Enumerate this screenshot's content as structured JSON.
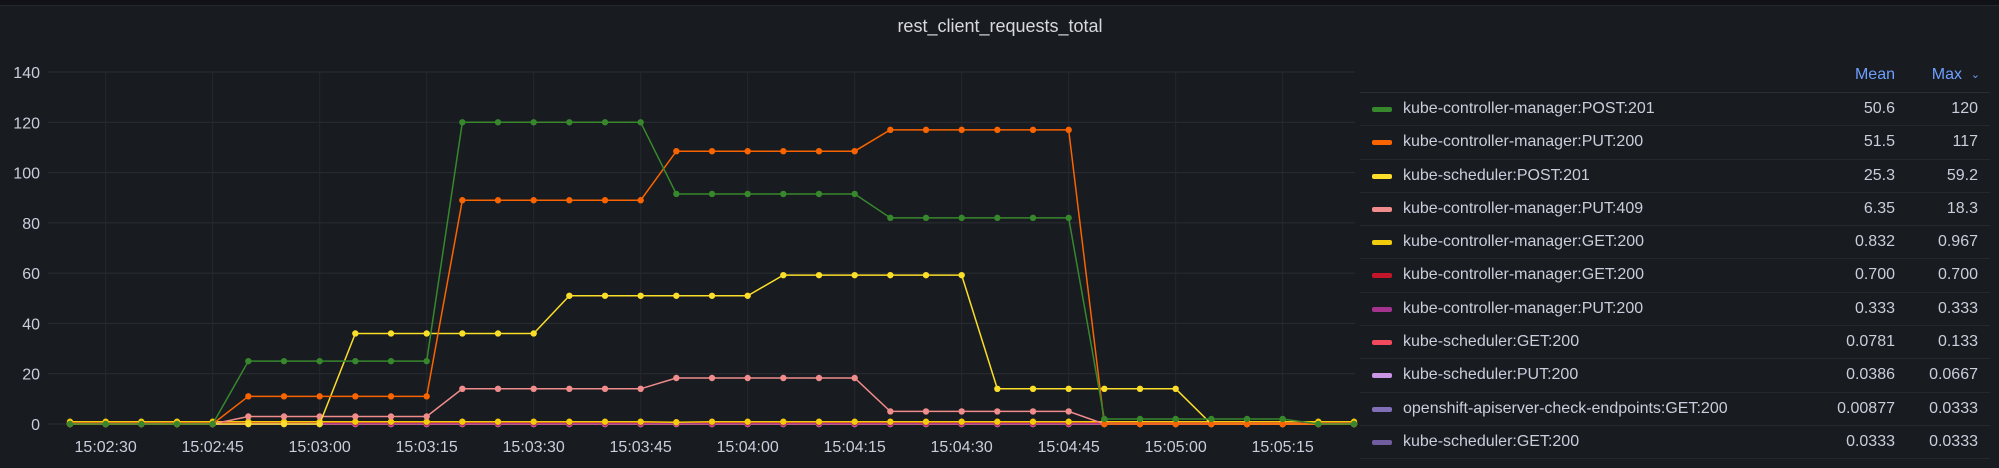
{
  "chart_data": {
    "type": "line",
    "title": "rest_client_requests_total",
    "xlabel": "",
    "ylabel": "",
    "ylim": [
      0,
      140
    ],
    "yticks": [
      "0",
      "20",
      "40",
      "60",
      "80",
      "100",
      "120",
      "140"
    ],
    "xticks": [
      "15:02:30",
      "15:02:45",
      "15:03:00",
      "15:03:15",
      "15:03:30",
      "15:03:45",
      "15:04:00",
      "15:04:15",
      "15:04:30",
      "15:04:45",
      "15:05:00",
      "15:05:15"
    ],
    "x_start": "15:02:25",
    "x_step_seconds": 5,
    "grid": true,
    "legend_placement": "right",
    "legend_columns": [
      "Mean",
      "Max"
    ],
    "series": [
      {
        "name": "kube-controller-manager:POST:201",
        "color": "#37872d",
        "mean": "50.6",
        "max": "120",
        "values": [
          0,
          0,
          0,
          0,
          0,
          25,
          25,
          25,
          25,
          25,
          25,
          120,
          120,
          120,
          120,
          120,
          120,
          91.5,
          91.5,
          91.5,
          91.5,
          91.5,
          91.5,
          82,
          82,
          82,
          82,
          82,
          82,
          2,
          2,
          2,
          2,
          2,
          2,
          0,
          0
        ]
      },
      {
        "name": "kube-controller-manager:PUT:200",
        "color": "#fa6400",
        "mean": "51.5",
        "max": "117",
        "values": [
          0,
          0,
          0,
          0,
          0,
          11,
          11,
          11,
          11,
          11,
          11,
          89,
          89,
          89,
          89,
          89,
          89,
          108.5,
          108.5,
          108.5,
          108.5,
          108.5,
          108.5,
          117,
          117,
          117,
          117,
          117,
          117,
          0,
          0,
          0,
          0,
          0,
          0,
          0,
          0
        ]
      },
      {
        "name": "kube-scheduler:POST:201",
        "color": "#fade2a",
        "mean": "25.3",
        "max": "59.2",
        "values": [
          0,
          0,
          0,
          0,
          0,
          0,
          0,
          0,
          36,
          36,
          36,
          36,
          36,
          36,
          51,
          51,
          51,
          51,
          51,
          51,
          59.2,
          59.2,
          59.2,
          59.2,
          59.2,
          59.2,
          14,
          14,
          14,
          14,
          14,
          14,
          0,
          0,
          0,
          0,
          0
        ]
      },
      {
        "name": "kube-controller-manager:PUT:409",
        "color": "#f08c8c",
        "mean": "6.35",
        "max": "18.3",
        "values": [
          0,
          0,
          0,
          0,
          0,
          3,
          3,
          3,
          3,
          3,
          3,
          14,
          14,
          14,
          14,
          14,
          14,
          18.3,
          18.3,
          18.3,
          18.3,
          18.3,
          18.3,
          5,
          5,
          5,
          5,
          5,
          5,
          0,
          0,
          0,
          0,
          0,
          0,
          0,
          0
        ]
      },
      {
        "name": "kube-controller-manager:GET:200",
        "color": "#f2cc0c",
        "mean": "0.832",
        "max": "0.967",
        "values": [
          0.9,
          0.9,
          0.9,
          0.9,
          0.9,
          0.9,
          0.9,
          0.9,
          0.9,
          0.9,
          0.9,
          0.9,
          0.9,
          0.9,
          0.9,
          0.9,
          0.9,
          0.7,
          0.9,
          0.9,
          0.9,
          0.9,
          0.9,
          0.9,
          0.9,
          0.9,
          0.9,
          0.9,
          0.9,
          0.9,
          0.9,
          0.9,
          0.9,
          0.9,
          0.9,
          0.9,
          0.9
        ]
      },
      {
        "name": "kube-controller-manager:GET:200",
        "color": "#c4162a",
        "mean": "0.700",
        "max": "0.700",
        "values": [
          0.7,
          0.7,
          0.7,
          0.7,
          0.7,
          0.7,
          0.7,
          0.7,
          0.7,
          0.7,
          0.7,
          0.7,
          0.7,
          0.7,
          0.7,
          0.7,
          0.7,
          0.7,
          0.7,
          0.7,
          0.7,
          0.7,
          0.7,
          0.7,
          0.7,
          0.7,
          0.7,
          0.7,
          0.7,
          0.7,
          0.7,
          0.7,
          0.7,
          0.7,
          0.7,
          0.7,
          0.7
        ]
      },
      {
        "name": "kube-controller-manager:PUT:200",
        "color": "#a3338f",
        "mean": "0.333",
        "max": "0.333",
        "values": [
          0.333,
          0.333,
          0.333,
          0.333,
          0.333,
          0.333,
          0.333,
          0.333,
          0.333,
          0.333,
          0.333,
          0.333,
          0.333,
          0.333,
          0.333,
          0.333,
          0.333,
          0.333,
          0.333,
          0.333,
          0.333,
          0.333,
          0.333,
          0.333,
          0.333,
          0.333,
          0.333,
          0.333,
          0.333,
          0.333,
          0.333,
          0.333,
          0.333,
          0.333,
          0.333,
          0.333,
          0.333
        ]
      },
      {
        "name": "kube-scheduler:GET:200",
        "color": "#f2495c",
        "mean": "0.0781",
        "max": "0.133",
        "values": [
          0.1,
          0.1,
          0.1,
          0.1,
          0.1,
          0.1,
          0.1,
          0.1,
          0.1,
          0.1,
          0.1,
          0.1,
          0.1,
          0.1,
          0.1,
          0.1,
          0.1,
          0.1,
          0.1,
          0.1,
          0.1,
          0.1,
          0.1,
          0.1,
          0.1,
          0.1,
          0.1,
          0.1,
          0.1,
          0.1,
          0.1,
          0.1,
          0.1,
          0.1,
          0.1,
          0.1,
          0.1
        ]
      },
      {
        "name": "kube-scheduler:PUT:200",
        "color": "#ca95e5",
        "mean": "0.0386",
        "max": "0.0667",
        "values": [
          0.04,
          0.04,
          0.04,
          0.04,
          0.04,
          0.04,
          0.04,
          0.04,
          0.04,
          0.04,
          0.04,
          0.04,
          0.04,
          0.04,
          0.04,
          0.04,
          0.04,
          0.04,
          0.04,
          0.04,
          0.04,
          0.04,
          0.04,
          0.04,
          0.04,
          0.04,
          0.04,
          0.04,
          0.04,
          0.04,
          0.04,
          0.04,
          0.04,
          0.04,
          0.04,
          0.04,
          0.04
        ]
      },
      {
        "name": "openshift-apiserver-check-endpoints:GET:200",
        "color": "#806eb7",
        "mean": "0.00877",
        "max": "0.0333",
        "values": [
          0,
          0,
          0,
          0,
          0,
          0,
          0,
          0,
          0,
          0,
          0,
          0,
          0,
          0,
          0,
          0,
          0,
          0,
          0,
          0,
          0,
          0,
          0,
          0,
          0,
          0,
          0,
          0,
          0,
          0,
          0,
          0,
          0,
          0,
          0,
          0,
          0
        ]
      },
      {
        "name": "kube-scheduler:GET:200",
        "color": "#705da0",
        "mean": "0.0333",
        "max": "0.0333",
        "values": [
          0.033,
          0.033,
          0.033,
          0.033,
          0.033,
          0.033,
          0.033,
          0.033,
          0.033,
          0.033,
          0.033,
          0.033,
          0.033,
          0.033,
          0.033,
          0.033,
          0.033,
          0.033,
          0.033,
          0.033,
          0.033,
          0.033,
          0.033,
          0.033,
          0.033,
          0.033,
          0.033,
          0.033,
          0.033,
          0.033,
          0.033,
          0.033,
          0.033,
          0.033,
          0.033,
          0.033,
          0.033
        ]
      },
      {
        "color": "#6ab7c8",
        "values": [
          0,
          0,
          0,
          0,
          0,
          0,
          0,
          0,
          0,
          0,
          0,
          0,
          0,
          0,
          0,
          0,
          0,
          0,
          0,
          0,
          0,
          0,
          0,
          0,
          0,
          0,
          0,
          0,
          0,
          0,
          0,
          0,
          0,
          0,
          0,
          0,
          0
        ]
      }
    ]
  }
}
